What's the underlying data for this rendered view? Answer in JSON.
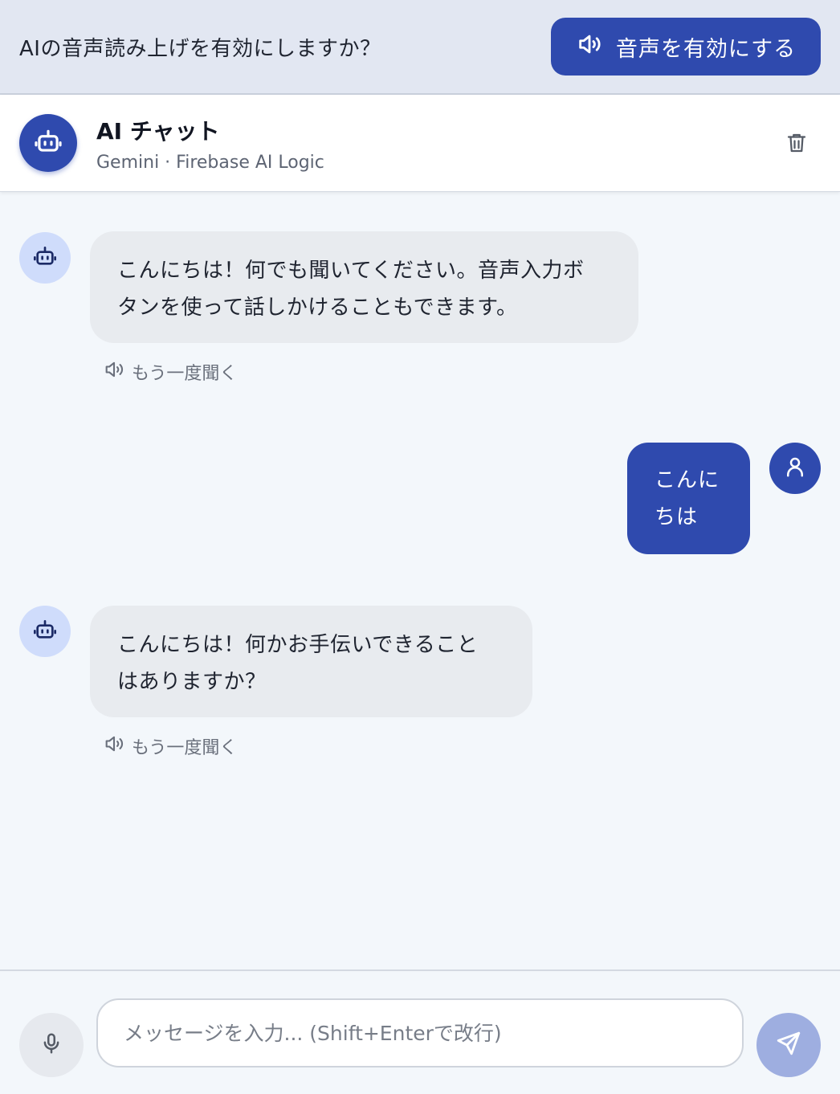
{
  "banner": {
    "prompt": "AIの音声読み上げを有効にしますか？",
    "enable_label": "音声を有効にする",
    "enable_icon": "speaker-icon"
  },
  "header": {
    "title": "AI チャット",
    "subtitle": "Gemini · Firebase AI Logic",
    "avatar_icon": "robot-icon",
    "delete_icon": "trash-icon"
  },
  "messages": [
    {
      "role": "assistant",
      "lines": [
        "こんにちは！何でも聞いてください。音声入力ボ",
        "タンを使って話しかけることもできます。"
      ],
      "replay_label": "もう一度聞く"
    },
    {
      "role": "user",
      "lines": [
        "こんに",
        "ちは"
      ]
    },
    {
      "role": "assistant",
      "lines": [
        "こんにちは！何かお手伝いできること",
        "はありますか？"
      ],
      "replay_label": "もう一度聞く"
    }
  ],
  "composer": {
    "placeholder": "メッセージを入力... (Shift+Enterで改行)",
    "value": "",
    "mic_icon": "microphone-icon",
    "send_icon": "send-icon"
  },
  "colors": {
    "accent": "#2f4aae",
    "bot_bubble": "#e8ebef",
    "bot_avatar_bg": "#cfdcfb",
    "banner_bg": "#e2e7f2",
    "send_disabled": "#9eaee0",
    "page_bg": "#f3f7fb"
  }
}
